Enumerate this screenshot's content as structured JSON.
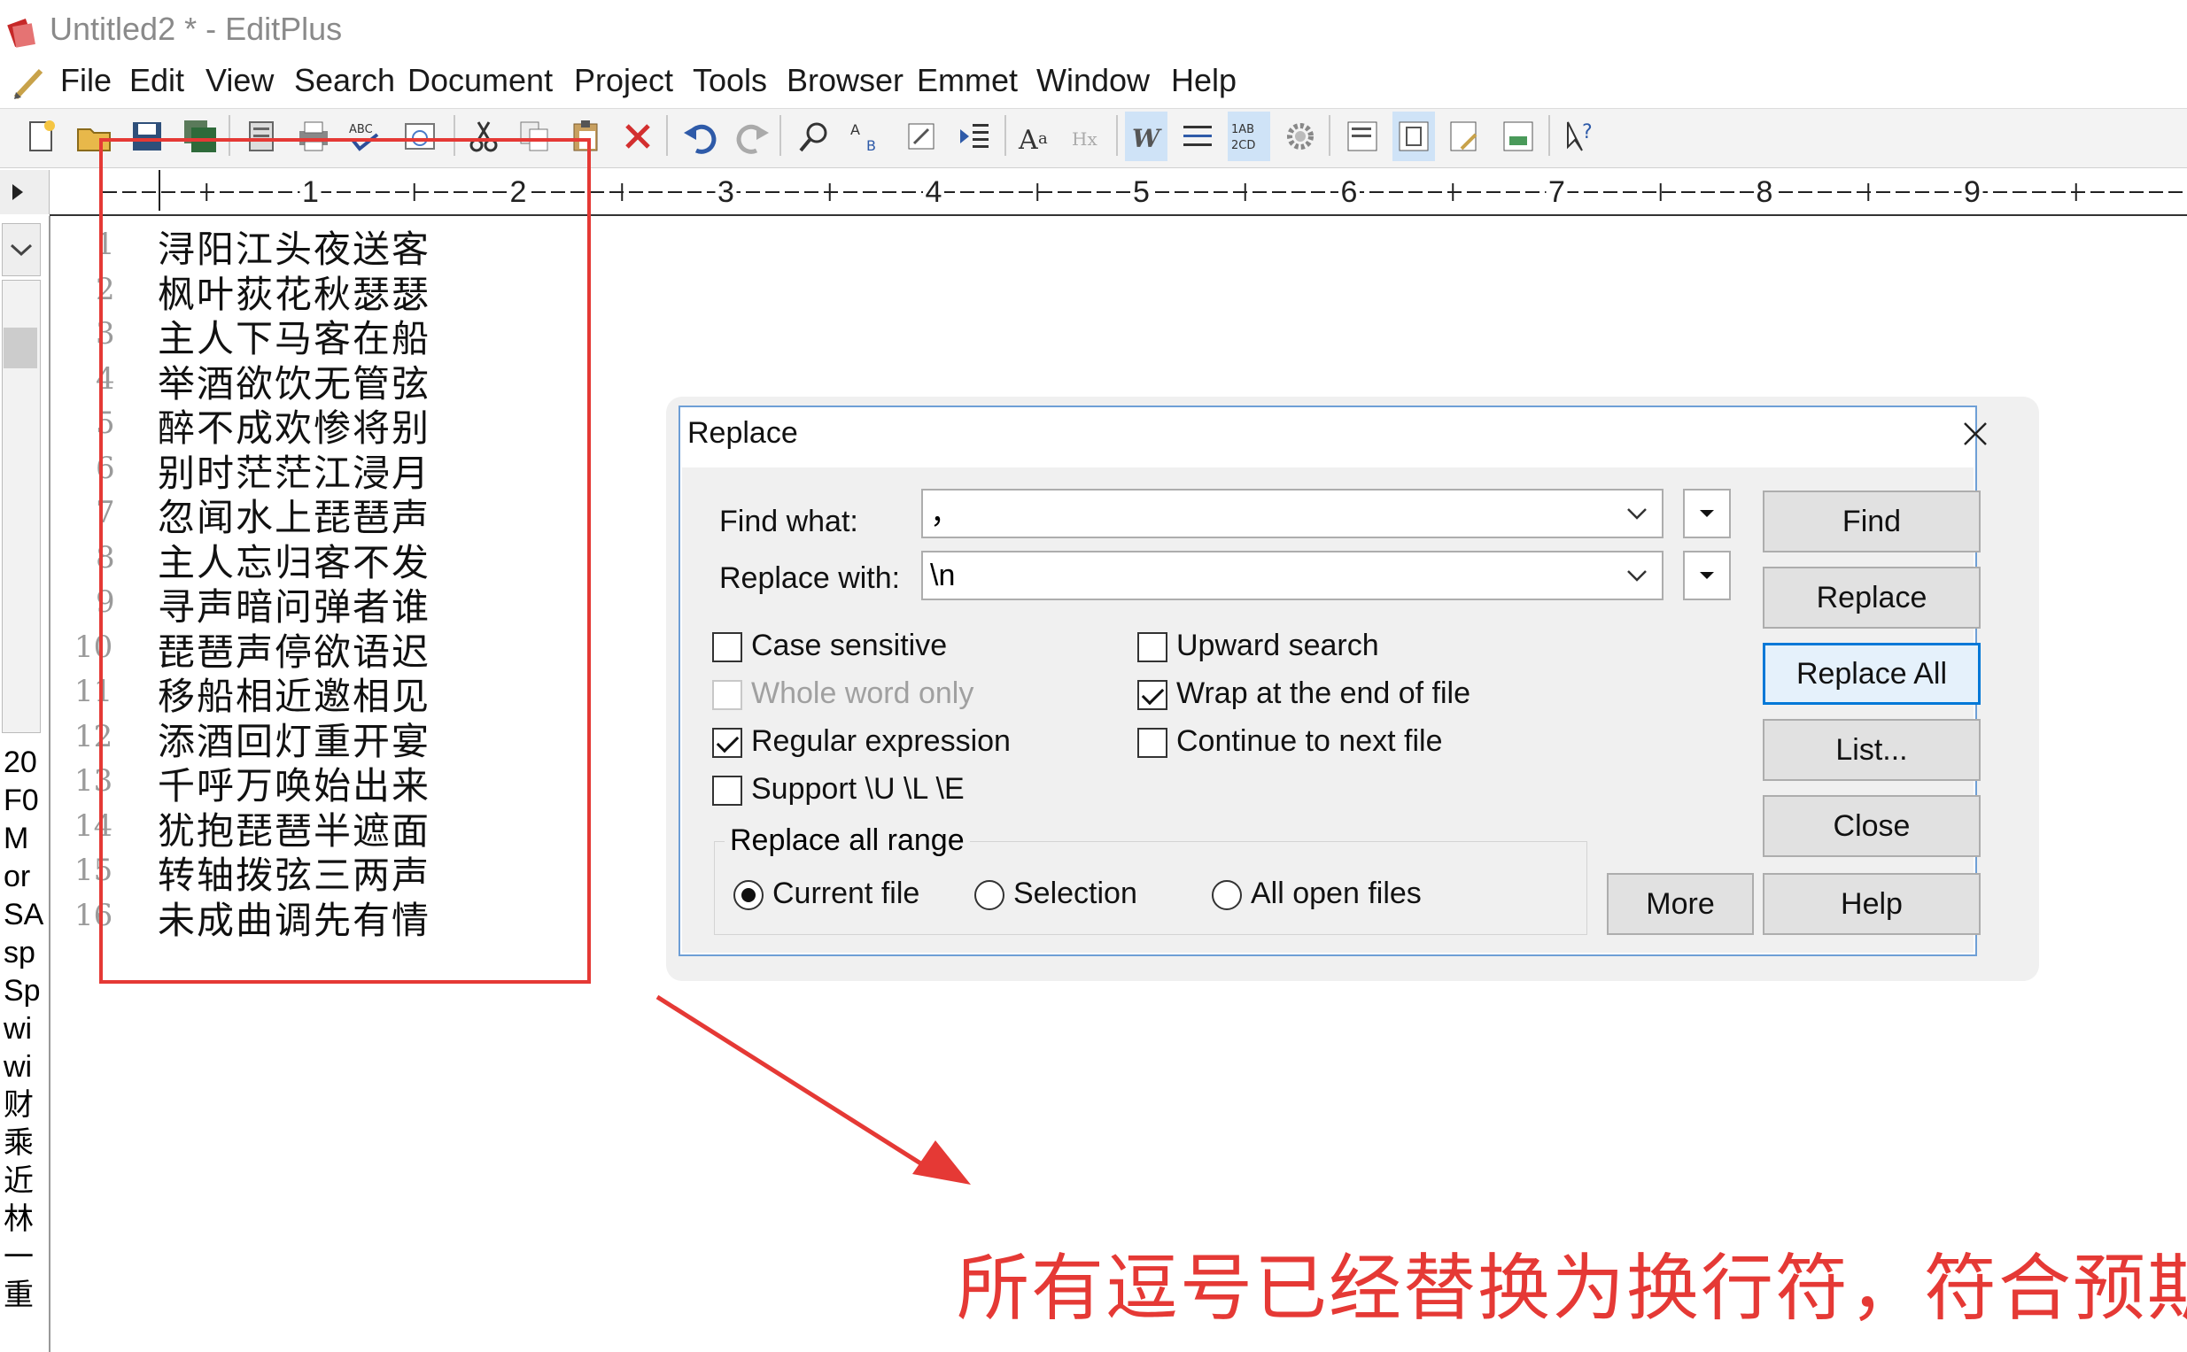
{
  "window": {
    "title": "Untitled2 * - EditPlus"
  },
  "menu": [
    "File",
    "Edit",
    "View",
    "Search",
    "Document",
    "Project",
    "Tools",
    "Browser",
    "Emmet",
    "Window",
    "Help"
  ],
  "toolbar": [
    "new-file-icon",
    "open-file-icon",
    "save-icon",
    "save-all-icon",
    "print-preview-icon",
    "print-icon",
    "spellcheck-icon",
    "browser-preview-icon",
    "cut-icon",
    "copy-icon",
    "paste-icon",
    "delete-icon",
    "undo-icon",
    "redo-icon",
    "find-icon",
    "replace-icon",
    "goto-icon",
    "indent-icon",
    "font-icon",
    "hex-icon",
    "word-wrap-icon",
    "line-wrap-icon",
    "line-number-icon",
    "settings-icon",
    "panel-icon",
    "directory-icon",
    "cliptext-icon",
    "output-icon",
    "help-context-icon"
  ],
  "ruler": {
    "marks": [
      "1",
      "2",
      "3",
      "4",
      "5",
      "6",
      "7",
      "8",
      "9"
    ]
  },
  "side_panel": {
    "text_lines": [
      "20",
      "F0",
      "M",
      "or",
      "SA",
      "sp",
      "Sp",
      "wi",
      "wi",
      "财",
      "乘",
      "近",
      "林",
      "一",
      "重"
    ]
  },
  "editor": {
    "lines": [
      {
        "n": "1",
        "text": "浔阳江头夜送客"
      },
      {
        "n": "2",
        "text": "枫叶荻花秋瑟瑟"
      },
      {
        "n": "3",
        "text": "主人下马客在船"
      },
      {
        "n": "4",
        "text": "举酒欲饮无管弦"
      },
      {
        "n": "5",
        "text": "醉不成欢惨将别"
      },
      {
        "n": "6",
        "text": "别时茫茫江浸月"
      },
      {
        "n": "7",
        "text": "忽闻水上琵琶声"
      },
      {
        "n": "8",
        "text": "主人忘归客不发"
      },
      {
        "n": "9",
        "text": "寻声暗问弹者谁"
      },
      {
        "n": "10",
        "text": "琵琶声停欲语迟"
      },
      {
        "n": "11",
        "text": "移船相近邀相见"
      },
      {
        "n": "12",
        "text": "添酒回灯重开宴"
      },
      {
        "n": "13",
        "text": "千呼万唤始出来"
      },
      {
        "n": "14",
        "text": "犹抱琵琶半遮面"
      },
      {
        "n": "15",
        "text": "转轴拨弦三两声"
      },
      {
        "n": "16",
        "text": "未成曲调先有情"
      }
    ]
  },
  "dialog": {
    "title": "Replace",
    "find_label": "Find what:",
    "find_value": "，",
    "replace_label": "Replace with:",
    "replace_value": "\\n",
    "buttons": {
      "find": "Find",
      "replace": "Replace",
      "replace_all": "Replace All",
      "list": "List...",
      "close": "Close",
      "more": "More",
      "help": "Help"
    },
    "options": {
      "case_sensitive": {
        "label": "Case sensitive",
        "checked": false
      },
      "whole_word": {
        "label": "Whole word only",
        "checked": false,
        "disabled": true
      },
      "regex": {
        "label": "Regular expression",
        "checked": true
      },
      "support_ule": {
        "label": "Support \\U \\L \\E",
        "checked": false
      },
      "upward": {
        "label": "Upward search",
        "checked": false
      },
      "wrap": {
        "label": "Wrap at the end of file",
        "checked": true
      },
      "continue_next": {
        "label": "Continue to next file",
        "checked": false
      }
    },
    "range": {
      "group_label": "Replace all range",
      "current_file": "Current file",
      "selection": "Selection",
      "all_open_files": "All open files",
      "selected": "current_file"
    }
  },
  "annotation": {
    "text": "所有逗号已经替换为换行符，符合预期",
    "color": "#e53935"
  }
}
